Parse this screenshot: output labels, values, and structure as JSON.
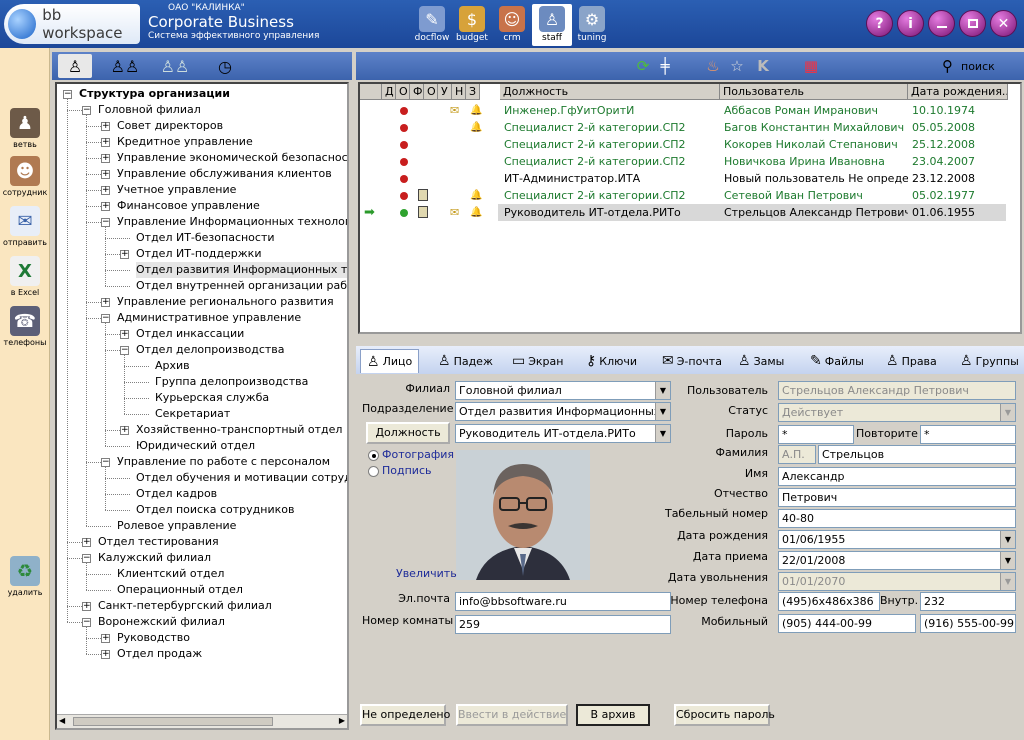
{
  "header": {
    "logo_text": "bb workspace",
    "company_line1": "ОАО \"КАЛИНКА\"",
    "company_line2": "Corporate Business",
    "company_line3": "Система эффективного управления",
    "modules": [
      {
        "label": "docflow",
        "icon": "docflow-icon"
      },
      {
        "label": "budget",
        "icon": "budget-icon"
      },
      {
        "label": "crm",
        "icon": "crm-icon"
      },
      {
        "label": "staff",
        "icon": "staff-icon"
      },
      {
        "label": "tuning",
        "icon": "tuning-icon"
      }
    ],
    "window_buttons": [
      "?",
      "i",
      "",
      "",
      ""
    ]
  },
  "leftbar": [
    {
      "label": "ветвь"
    },
    {
      "label": "сотрудник"
    },
    {
      "label": "отправить"
    },
    {
      "label": "в Excel"
    },
    {
      "label": "телефоны"
    },
    {
      "label": "удалить"
    }
  ],
  "tree": [
    {
      "label": "Структура организации",
      "lvl": 0,
      "box": "−",
      "bold": true
    },
    {
      "label": "Головной филиал",
      "lvl": 1,
      "box": "−"
    },
    {
      "label": "Совет директоров",
      "lvl": 2,
      "box": "+"
    },
    {
      "label": "Кредитное управление",
      "lvl": 2,
      "box": "+"
    },
    {
      "label": "Управление экономической безопасности",
      "lvl": 2,
      "box": "+"
    },
    {
      "label": "Управление обслуживания клиентов",
      "lvl": 2,
      "box": "+"
    },
    {
      "label": "Учетное управление",
      "lvl": 2,
      "box": "+"
    },
    {
      "label": "Финансовое управление",
      "lvl": 2,
      "box": "+"
    },
    {
      "label": "Управление Информационных технологий",
      "lvl": 2,
      "box": "−"
    },
    {
      "label": "Отдел ИТ-безопасности",
      "lvl": 3,
      "box": ""
    },
    {
      "label": "Отдел ИТ-поддержки",
      "lvl": 3,
      "box": "+"
    },
    {
      "label": "Отдел развития Информационных технол",
      "lvl": 3,
      "box": "",
      "sel": true
    },
    {
      "label": "Отдел внутренней организации работы и",
      "lvl": 3,
      "box": ""
    },
    {
      "label": "Управление регионального развития",
      "lvl": 2,
      "box": "+"
    },
    {
      "label": "Административное управление",
      "lvl": 2,
      "box": "−"
    },
    {
      "label": "Отдел инкассации",
      "lvl": 3,
      "box": "+"
    },
    {
      "label": "Отдел делопроизводства",
      "lvl": 3,
      "box": "−"
    },
    {
      "label": "Архив",
      "lvl": 4,
      "box": ""
    },
    {
      "label": "Группа делопроизводства",
      "lvl": 4,
      "box": ""
    },
    {
      "label": "Курьерская служба",
      "lvl": 4,
      "box": ""
    },
    {
      "label": "Секретариат",
      "lvl": 4,
      "box": ""
    },
    {
      "label": "Хозяйственно-транспортный отдел",
      "lvl": 3,
      "box": "+"
    },
    {
      "label": "Юридический отдел",
      "lvl": 3,
      "box": ""
    },
    {
      "label": "Управление по работе с персоналом",
      "lvl": 2,
      "box": "−"
    },
    {
      "label": "Отдел обучения и мотивации сотрудников",
      "lvl": 3,
      "box": ""
    },
    {
      "label": "Отдел кадров",
      "lvl": 3,
      "box": ""
    },
    {
      "label": "Отдел поиска сотрудников",
      "lvl": 3,
      "box": ""
    },
    {
      "label": "Ролевое управление",
      "lvl": 2,
      "box": ""
    },
    {
      "label": "Отдел тестирования",
      "lvl": 1,
      "box": "+"
    },
    {
      "label": "Калужский филиал",
      "lvl": 1,
      "box": "−"
    },
    {
      "label": "Клиентский отдел",
      "lvl": 2,
      "box": ""
    },
    {
      "label": "Операционный отдел",
      "lvl": 2,
      "box": ""
    },
    {
      "label": "Санкт-петербургский филиал",
      "lvl": 1,
      "box": "+"
    },
    {
      "label": "Воронежский филиал",
      "lvl": 1,
      "box": "−"
    },
    {
      "label": "Руководство",
      "lvl": 2,
      "box": "+"
    },
    {
      "label": "Отдел продаж",
      "lvl": 2,
      "box": "+"
    }
  ],
  "grid": {
    "toolbar_search": "поиск",
    "toolbar_k": "K",
    "headers": [
      "Д",
      "О",
      "Ф",
      "О",
      "У",
      "Н",
      "З",
      "Должность",
      "Пользователь",
      "Дата рождения..."
    ],
    "rows": [
      {
        "pos": "Инженер.ГфУитОритИ",
        "user": "Аббасов Роман Имранович",
        "date": "10.10.1974",
        "dot": "#c81e1e",
        "badge": false,
        "mail": true,
        "bell": true,
        "color": "green"
      },
      {
        "pos": "Специалист 2-й категории.СП2",
        "user": "Багов Константин Михайлович",
        "date": "05.05.2008",
        "dot": "#c81e1e",
        "badge": false,
        "mail": false,
        "bell": true,
        "color": "green"
      },
      {
        "pos": "Специалист 2-й категории.СП2",
        "user": "Кокорев Николай Степанович",
        "date": "25.12.2008",
        "dot": "#c81e1e",
        "badge": false,
        "mail": false,
        "bell": false,
        "color": "green"
      },
      {
        "pos": "Специалист 2-й категории.СП2",
        "user": "Новичкова Ирина Ивановна",
        "date": "23.04.2007",
        "dot": "#c81e1e",
        "badge": false,
        "mail": false,
        "bell": false,
        "color": "green"
      },
      {
        "pos": "ИТ-Администратор.ИТА",
        "user": "Новый пользователь Не опреде...",
        "date": "23.12.2008",
        "dot": "#c81e1e",
        "badge": false,
        "mail": false,
        "bell": false,
        "color": "black"
      },
      {
        "pos": "Специалист 2-й категории.СП2",
        "user": "Сетевой Иван Петрович",
        "date": "05.02.1977",
        "dot": "#c81e1e",
        "badge": true,
        "mail": false,
        "bell": true,
        "color": "green"
      },
      {
        "pos": "Руководитель ИТ-отдела.РИТо",
        "user": "Стрельцов Александр Петрович",
        "date": "01.06.1955",
        "dot": "#2fa32f",
        "badge": true,
        "mail": true,
        "bell": true,
        "color": "black",
        "sel": true
      }
    ]
  },
  "detail": {
    "tabs": [
      "Лицо",
      "Падеж",
      "Экран",
      "Ключи",
      "Э-почта",
      "Замы",
      "Файлы",
      "Права",
      "Группы"
    ],
    "filial_label": "Филиал",
    "filial_value": "Головной филиал",
    "dept_label": "Подразделение",
    "dept_value": "Отдел развития Информационных тех",
    "position_button": "Должность",
    "position_value": "Руководитель ИТ-отдела.РИТо",
    "radio_photo": "Фотография",
    "radio_sign": "Подпись",
    "enlarge": "Увеличить",
    "email_label": "Эл.почта",
    "email_value": "info@bbsoftware.ru",
    "room_label": "Номер комнаты",
    "room_value": "259",
    "user_label": "Пользователь",
    "user_value": "Стрельцов Александр Петрович",
    "status_label": "Статус",
    "status_value": "Действует",
    "password_label": "Пароль",
    "password_value": "*",
    "repeat_label": "Повторите",
    "repeat_value": "*",
    "lastname_label": "Фамилия",
    "initials_value": "А.П.",
    "lastname_value": "Стрельцов",
    "firstname_label": "Имя",
    "firstname_value": "Александр",
    "patronymic_label": "Отчество",
    "patronymic_value": "Петрович",
    "tabnum_label": "Табельный номер",
    "tabnum_value": "40-80",
    "birth_label": "Дата рождения",
    "birth_value": "01/06/1955",
    "hire_label": "Дата приема",
    "hire_value": "22/01/2008",
    "fire_label": "Дата увольнения",
    "fire_value": "01/01/2070",
    "phone_label": "Номер телефона",
    "phone_value": "(495)6x486x386",
    "ext_label": "Внутр.",
    "ext_value": "232",
    "mobile_label": "Мобильный",
    "mobile_value": "(905) 444-00-99",
    "mobile2_value": "(916) 555-00-99",
    "buttons": {
      "undefined": "Не определено",
      "activate": "Ввести в действие",
      "archive": "В архив",
      "reset": "Сбросить пароль"
    }
  }
}
